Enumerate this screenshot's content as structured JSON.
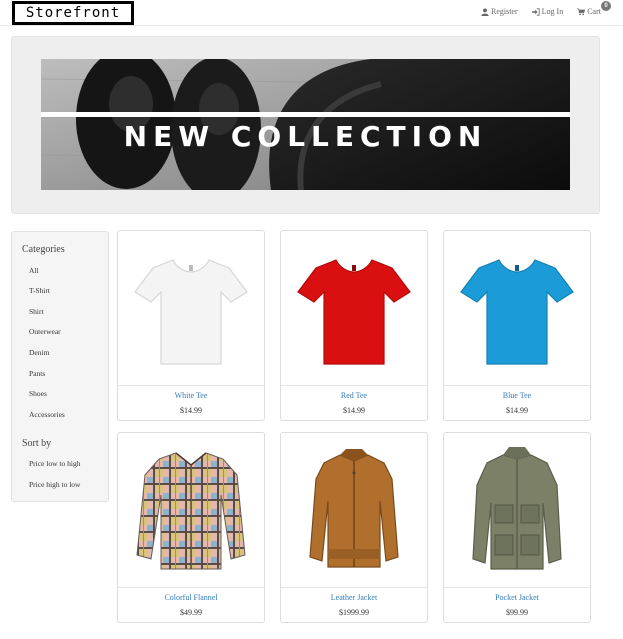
{
  "header": {
    "logo": "Storefront",
    "register_label": "Register",
    "login_label": "Log In",
    "cart_label": "Cart",
    "cart_count": "0"
  },
  "hero": {
    "title": "NEW COLLECTION"
  },
  "sidebar": {
    "categories_heading": "Categories",
    "categories": [
      "All",
      "T-Shirt",
      "Shirt",
      "Outerwear",
      "Denim",
      "Pants",
      "Shoes",
      "Accessories"
    ],
    "sort_heading": "Sort by",
    "sort_options": [
      "Price low to high",
      "Price high to low"
    ]
  },
  "products": [
    {
      "name": "White Tee",
      "price": "$14.99",
      "color": "#f4f4f4",
      "icon": "tshirt-icon"
    },
    {
      "name": "Red Tee",
      "price": "$14.99",
      "color": "#d9100f",
      "icon": "tshirt-icon"
    },
    {
      "name": "Blue Tee",
      "price": "$14.99",
      "color": "#1b9bd7",
      "icon": "tshirt-icon"
    },
    {
      "name": "Colorful Flannel",
      "price": "$49.99",
      "color": "#c9a5a0",
      "icon": "flannel-shirt-icon"
    },
    {
      "name": "Leather Jacket",
      "price": "$1999.99",
      "color": "#b06f2c",
      "icon": "leather-jacket-icon"
    },
    {
      "name": "Pocket Jacket",
      "price": "$99.99",
      "color": "#7b8067",
      "icon": "pocket-jacket-icon"
    }
  ]
}
